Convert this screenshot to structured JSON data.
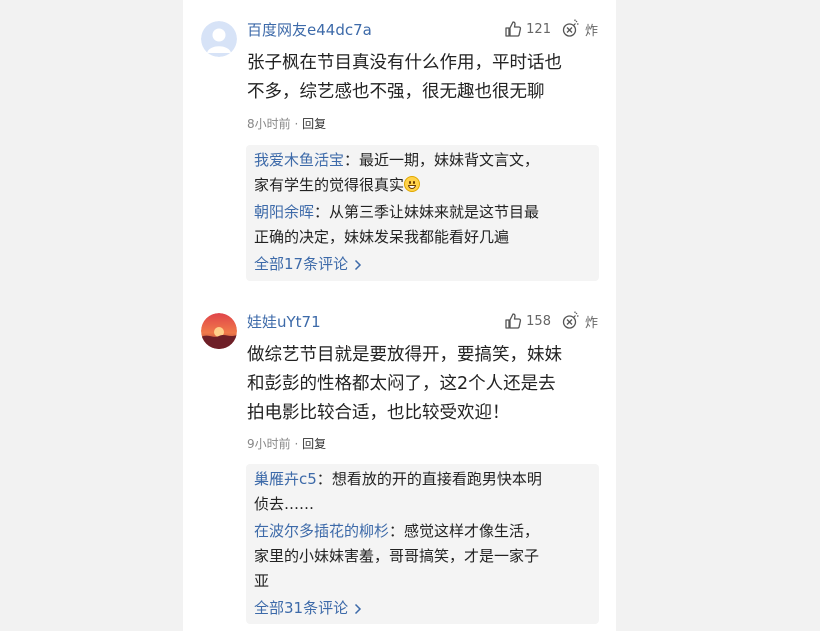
{
  "comments": [
    {
      "username": "百度网友e44dc7a",
      "avatar_icon": "default-user-avatar-icon",
      "likes": "121",
      "bomb_label": "炸",
      "content_lines": [
        "张子枫在节目真没有什么作用，平时话也",
        "不多，综艺感也不强，很无趣也很无聊"
      ],
      "time": "8小时前",
      "separator": "·",
      "reply_label": "回复",
      "replies": [
        {
          "user": "我爱木鱼活宝",
          "sep": "：",
          "text": "最近一期，妹妹背文言文，",
          "text2": "家有学生的觉得很真实",
          "emoji": "grinning-emoji-icon"
        },
        {
          "user": "朝阳余晖",
          "sep": "：",
          "text": "从第三季让妹妹来就是这节目最",
          "text2": "正确的决定，妹妹发呆我都能看好几遍"
        }
      ],
      "more_label": "全部17条评论"
    },
    {
      "username": "娃娃uYt71",
      "avatar_icon": "sunset-avatar-icon",
      "likes": "158",
      "bomb_label": "炸",
      "content_lines": [
        "做综艺节目就是要放得开，要搞笑，妹妹",
        "和彭彭的性格都太闷了，这2个人还是去",
        "拍电影比较合适，也比较受欢迎！"
      ],
      "time": "9小时前",
      "separator": "·",
      "reply_label": "回复",
      "replies": [
        {
          "user": "巢雁卉c5",
          "sep": "：",
          "text": "想看放的开的直接看跑男快本明",
          "text2": "侦去……"
        },
        {
          "user": "在波尔多插花的柳杉",
          "sep": "：",
          "text": "感觉这样才像生活，",
          "text2": "家里的小妹妹害羞，哥哥搞笑，才是一家子",
          "text3": "亚"
        }
      ],
      "more_label": "全部31条评论"
    }
  ],
  "colors": {
    "link": "#3d6aa9",
    "text": "#222222",
    "meta": "#888888",
    "reply_bg": "#f4f4f4"
  }
}
